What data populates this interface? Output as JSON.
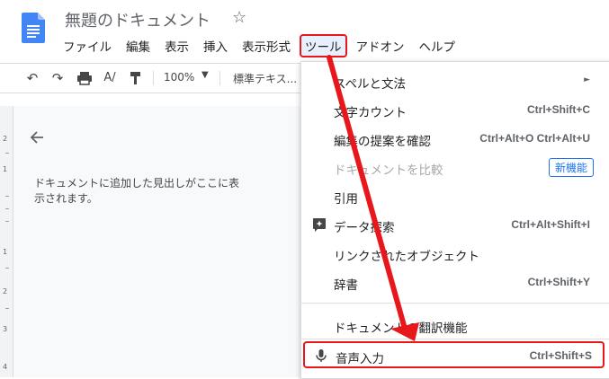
{
  "document": {
    "title": "無題のドキュメント"
  },
  "menubar": {
    "items": [
      "ファイル",
      "編集",
      "表示",
      "挿入",
      "表示形式",
      "ツール",
      "アドオン",
      "ヘルプ"
    ]
  },
  "toolbar": {
    "zoom": "100%",
    "style": "標準テキス..."
  },
  "ruler": {
    "numbers": [
      "2",
      "1",
      "1",
      "2",
      "3",
      "4"
    ]
  },
  "outline": {
    "hint": "ドキュメントに追加した見出しがここに表示されます。"
  },
  "tools_menu": {
    "spelling": "スペルと文法",
    "word_count": {
      "label": "文字カウント",
      "shortcut": "Ctrl+Shift+C"
    },
    "review_edits": {
      "label": "編集の提案を確認",
      "shortcut": "Ctrl+Alt+O Ctrl+Alt+U"
    },
    "compare": {
      "label": "ドキュメントを比較",
      "badge": "新機能"
    },
    "citations": "引用",
    "explore": {
      "label": "データ探索",
      "shortcut": "Ctrl+Alt+Shift+I"
    },
    "linked_objects": "リンクされたオブジェクト",
    "dictionary": {
      "label": "辞書",
      "shortcut": "Ctrl+Shift+Y"
    },
    "translate": "ドキュメントの翻訳機能",
    "voice_typing": {
      "label": "音声入力",
      "shortcut": "Ctrl+Shift+S"
    }
  },
  "colors": {
    "accent": "#1a73e8",
    "annotation": "#e8171b"
  }
}
